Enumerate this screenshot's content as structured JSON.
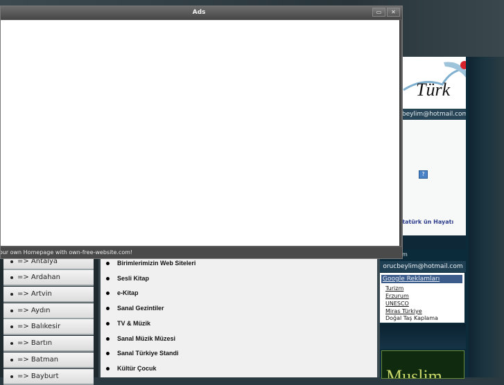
{
  "window": {
    "title": "Ads",
    "status": "Your own Homepage with own-free-website.com!",
    "restore_glyph": "▭",
    "close_glyph": "✕"
  },
  "left_menu": {
    "items": [
      {
        "label": "=> Antalya"
      },
      {
        "label": "=> Ardahan"
      },
      {
        "label": "=> Artvin"
      },
      {
        "label": "=> Aydın"
      },
      {
        "label": "=> Balıkesir"
      },
      {
        "label": "=> Bartın"
      },
      {
        "label": "=> Batman"
      },
      {
        "label": "=> Bayburt"
      }
    ]
  },
  "center_list": {
    "items": [
      {
        "label": "Birimlerimizin Web Siteleri"
      },
      {
        "label": "Sesli Kitap"
      },
      {
        "label": "e-Kitap"
      },
      {
        "label": "Sanal Gezintiler"
      },
      {
        "label": "TV & Müzik"
      },
      {
        "label": "Sanal Müzik Müzesi"
      },
      {
        "label": "Sanal Türkiye Standi"
      },
      {
        "label": "Kültür Çocuk"
      }
    ]
  },
  "right_col": {
    "logo_text": "Türk",
    "email": "orucbeylim@hotmail.com",
    "question_mark": "?",
    "ataturk_link": "Atatürk ün Hayatı",
    "m_text": "m",
    "email2": "orucbeylim@hotmail.com",
    "ads_header": "Google Reklamları",
    "ads": [
      {
        "label": "Turizm",
        "link": true
      },
      {
        "label": "Erzurum",
        "link": true
      },
      {
        "label": "UNESCO",
        "link": true
      },
      {
        "label": "Miras Türkiye",
        "link": true
      },
      {
        "label": "Doğal Taş Kaplama",
        "link": false
      }
    ],
    "banner_text": "Muslim"
  },
  "colors": {
    "window_title_bg": "#474747",
    "accent_blue": "#3b5c8a",
    "dark_teal": "#0b2b3a"
  }
}
